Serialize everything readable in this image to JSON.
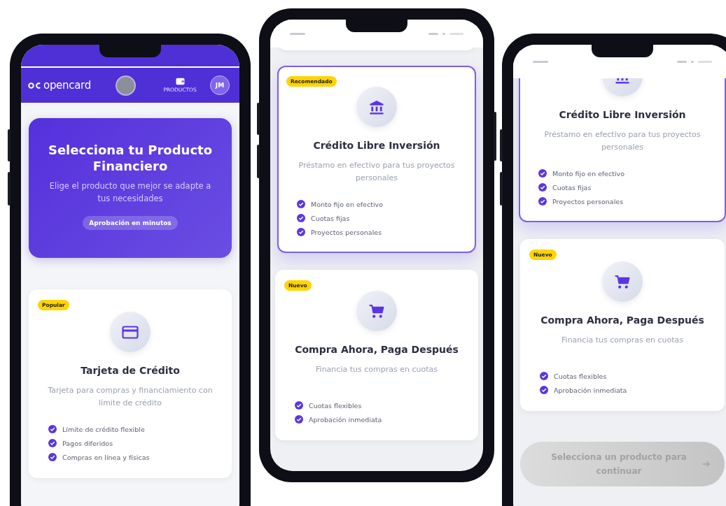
{
  "phones": [
    {
      "kind": "home",
      "header": {
        "logo": "opencard",
        "nav_label": "PRODUCTOS",
        "avatar_initials": "JM"
      },
      "hero": {
        "title": "Selecciona tu Producto Financiero",
        "subtitle": "Elige el producto que mejor se adapte a tus necesidades",
        "badge": "Aprobación en minutos"
      },
      "products": [
        {
          "kind": "card",
          "badge": "Popular",
          "title": "Tarjeta de Crédito",
          "description": "Tarjeta para compras y financiamiento con límite de crédito",
          "features": [
            "Límite de crédito flexible",
            "Pagos diferidos",
            "Compras en línea y físicas"
          ],
          "selected": false
        }
      ]
    },
    {
      "kind": "list",
      "products": [
        {
          "kind": "bank",
          "badge": "Recomendado",
          "title": "Crédito Libre Inversión",
          "description": "Préstamo en efectivo para tus proyectos personales",
          "features": [
            "Monto fijo en efectivo",
            "Cuotas fijas",
            "Proyectos personales"
          ],
          "selected": true
        },
        {
          "kind": "cart",
          "badge": "Nuevo",
          "title": "Compra Ahora, Paga Después",
          "description": "Financia tus compras en cuotas",
          "features": [
            "Cuotas flexibles",
            "Aprobación inmediata"
          ],
          "selected": false
        }
      ]
    },
    {
      "kind": "list",
      "products": [
        {
          "kind": "bank",
          "title": "Crédito Libre Inversión",
          "description": "Préstamo en efectivo para tus proyectos personales",
          "features": [
            "Monto fijo en efectivo",
            "Cuotas fijas",
            "Proyectos personales"
          ],
          "selected": true
        },
        {
          "kind": "cart",
          "badge": "Nuevo",
          "title": "Compra Ahora, Paga Después",
          "description": "Financia tus compras en cuotas",
          "features": [
            "Cuotas flexibles",
            "Aprobación inmediata"
          ],
          "selected": false
        }
      ],
      "continue_button": {
        "label": "Selecciona un producto para continuar",
        "disabled": true
      }
    }
  ]
}
